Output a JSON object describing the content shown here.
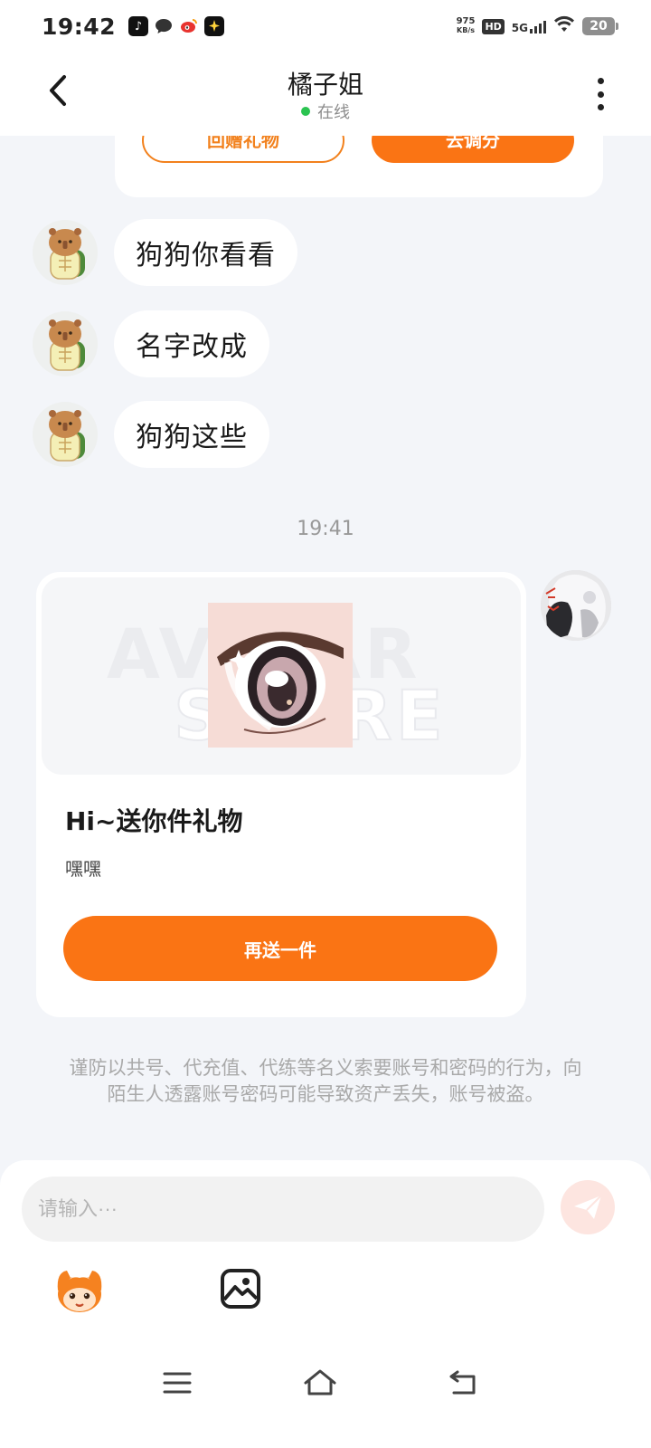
{
  "status_bar": {
    "time": "19:42",
    "net_speed_value": "975",
    "net_speed_unit": "KB/s",
    "hd": "HD",
    "network": "5G",
    "battery": "20"
  },
  "header": {
    "title": "橘子姐",
    "status": "在线",
    "status_color": "#2bc451"
  },
  "top_card": {
    "left_button": "回赠礼物",
    "right_button": "去调分"
  },
  "messages": [
    {
      "text": "狗狗你看看"
    },
    {
      "text": "名字改成"
    },
    {
      "text": "狗狗这些"
    }
  ],
  "timestamp": "19:41",
  "gift_card": {
    "watermark_line1": "AVATAR",
    "watermark_line2": "STORE",
    "title": "Hi~送你件礼物",
    "subtitle": "嘿嘿",
    "button": "再送一件"
  },
  "warning": "谨防以共号、代充值、代练等名义索要账号和密码的行为，向陌生人透露账号密码可能导致资产丢失，账号被盗。",
  "input": {
    "placeholder": "请输入···"
  },
  "colors": {
    "accent": "#fa7414",
    "background": "#f3f5f9"
  }
}
